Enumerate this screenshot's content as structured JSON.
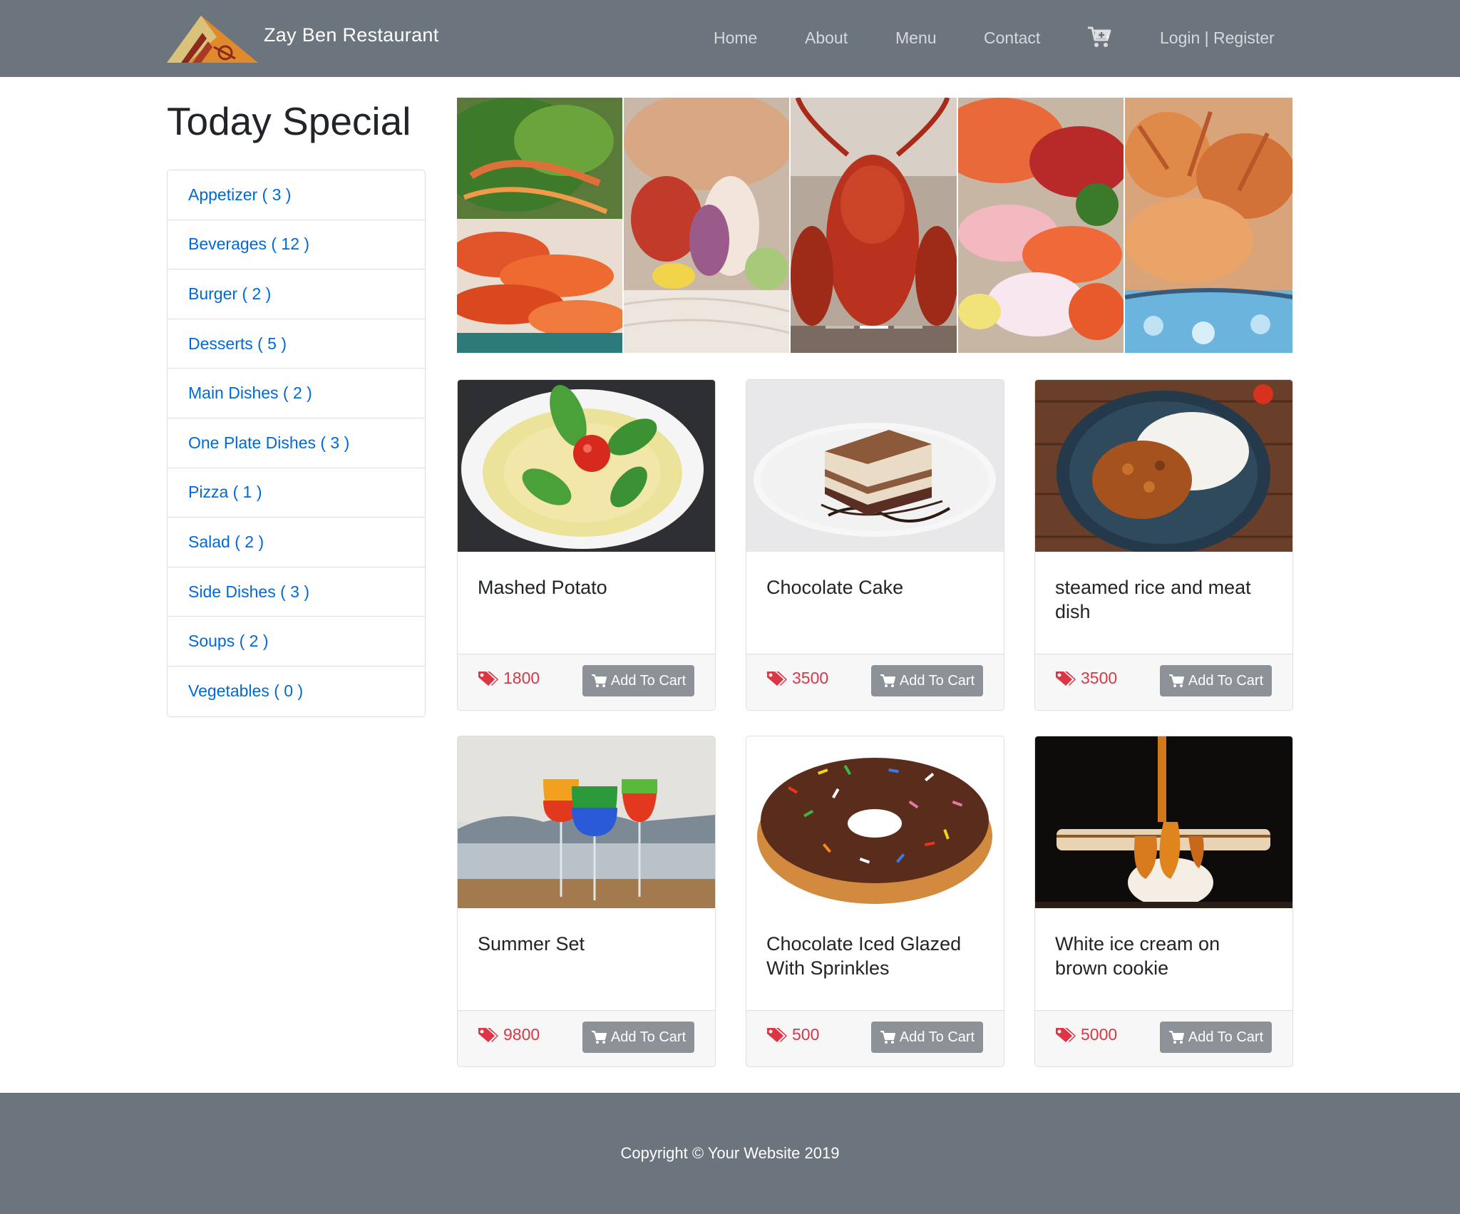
{
  "brand": {
    "name": "Zay Ben Restaurant",
    "logo_icon": "restaurant-logo-icon"
  },
  "nav": {
    "items": [
      {
        "label": "Home"
      },
      {
        "label": "About"
      },
      {
        "label": "Menu"
      },
      {
        "label": "Contact"
      }
    ],
    "cart_icon": "cart-icon",
    "auth_label": "Login | Register"
  },
  "sidebar": {
    "title": "Today Special",
    "categories": [
      {
        "label": "Appetizer ( 3 )"
      },
      {
        "label": "Beverages ( 12 )"
      },
      {
        "label": "Burger ( 2 )"
      },
      {
        "label": "Desserts ( 5 )"
      },
      {
        "label": "Main Dishes ( 2 )"
      },
      {
        "label": "One Plate Dishes ( 3 )"
      },
      {
        "label": "Pizza ( 1 )"
      },
      {
        "label": "Salad ( 2 )"
      },
      {
        "label": "Side Dishes ( 3 )"
      },
      {
        "label": "Soups ( 2 )"
      },
      {
        "label": "Vegetables ( 0 )"
      }
    ]
  },
  "carousel": {
    "slides": [
      "shrimp-salad-photo",
      "seafood-platter-photo",
      "lobster-photo",
      "sashimi-photo",
      "crab-on-ice-photo"
    ],
    "indicator_count": 3,
    "active_indicator": 1
  },
  "products": [
    {
      "name": "Mashed Potato",
      "price": "1800",
      "button": "Add To Cart"
    },
    {
      "name": "Chocolate Cake",
      "price": "3500",
      "button": "Add To Cart"
    },
    {
      "name": "steamed rice and meat dish",
      "price": "3500",
      "button": "Add To Cart"
    },
    {
      "name": "Summer Set",
      "price": "9800",
      "button": "Add To Cart"
    },
    {
      "name": "Chocolate Iced Glazed With Sprinkles",
      "price": "500",
      "button": "Add To Cart"
    },
    {
      "name": "White ice cream on brown cookie",
      "price": "5000",
      "button": "Add To Cart"
    }
  ],
  "colors": {
    "navbar": "#6c757d",
    "link": "#0069d9",
    "price": "#dc3545",
    "button": "#8c9297"
  },
  "footer": {
    "copyright": "Copyright © Your Website 2019"
  }
}
